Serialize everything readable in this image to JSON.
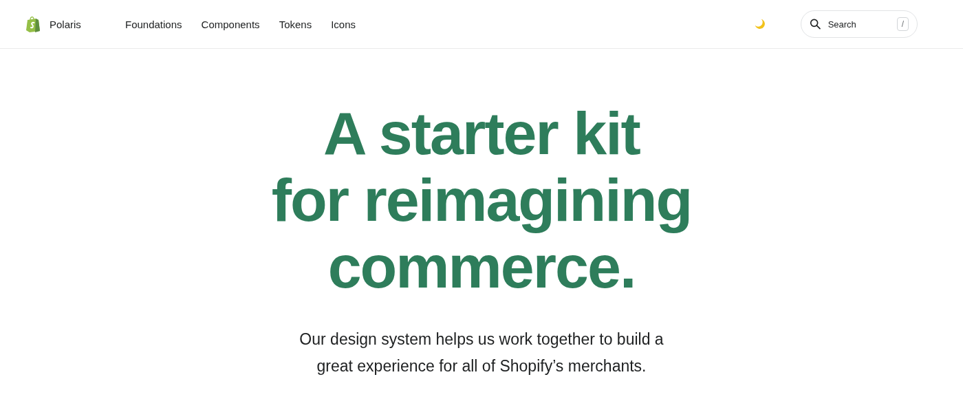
{
  "header": {
    "brand": "Polaris",
    "nav": [
      {
        "label": "Foundations"
      },
      {
        "label": "Components"
      },
      {
        "label": "Tokens"
      },
      {
        "label": "Icons"
      }
    ],
    "search": {
      "placeholder": "Search",
      "shortcut": "/"
    }
  },
  "hero": {
    "headline_lines": [
      "A starter kit",
      "for reimagining",
      "commerce."
    ],
    "intro_lines": [
      "Our design system helps us work together to build a",
      "great experience for all of Shopify’s merchants."
    ]
  }
}
